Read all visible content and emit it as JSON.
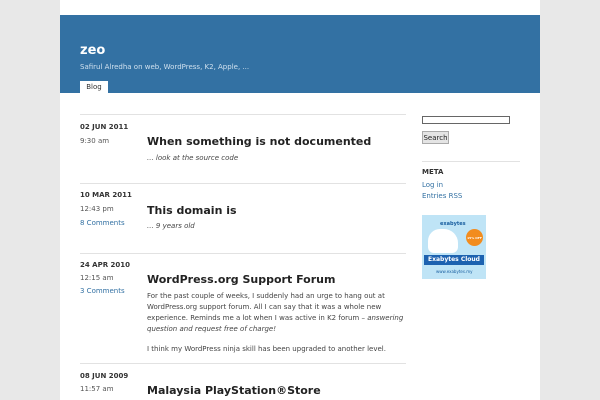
{
  "site": {
    "title": "zeo",
    "description": "Safirul Alredha on web, WordPress, K2, Apple, ...",
    "tab_label": "Blog"
  },
  "posts": [
    {
      "date": "02 JUN 2011",
      "time": "9:30 am",
      "comments": "",
      "title": "When something is not documented",
      "excerpt": "... look at the source code"
    },
    {
      "date": "10 MAR 2011",
      "time": "12:43 pm",
      "comments": "8 Comments",
      "title": "This domain is",
      "excerpt": "... 9 years old"
    },
    {
      "date": "24 APR 2010",
      "time": "12:15 am",
      "comments": "3 Comments",
      "title": "WordPress.org Support Forum",
      "body_p1_start": "For the past couple of weeks, I suddenly had an urge to hang out at WordPress.org support forum. All I can say that it was a whole new experience. Reminds me a lot when I was active in K2 forum – ",
      "body_p1_em": "answering question and request free of charge!",
      "body_p2": "I think my WordPress ninja skill has been upgraded to another level."
    },
    {
      "date": "08 JUN 2009",
      "time": "11:57 am",
      "comments": "",
      "title": "Malaysia PlayStation®Store"
    }
  ],
  "sidebar": {
    "search_value": "",
    "search_button": "Search",
    "meta_heading": "META",
    "meta_links": [
      "Log in",
      "Entries RSS"
    ],
    "ad": {
      "brand": "exabytes",
      "badge": "15% OFF NOW",
      "headline": "Exabytes Cloud",
      "url": "www.exabytes.my"
    }
  },
  "colors": {
    "header_bg": "#3371a3",
    "link": "#3371a3",
    "page_bg": "#e8e8e8"
  }
}
